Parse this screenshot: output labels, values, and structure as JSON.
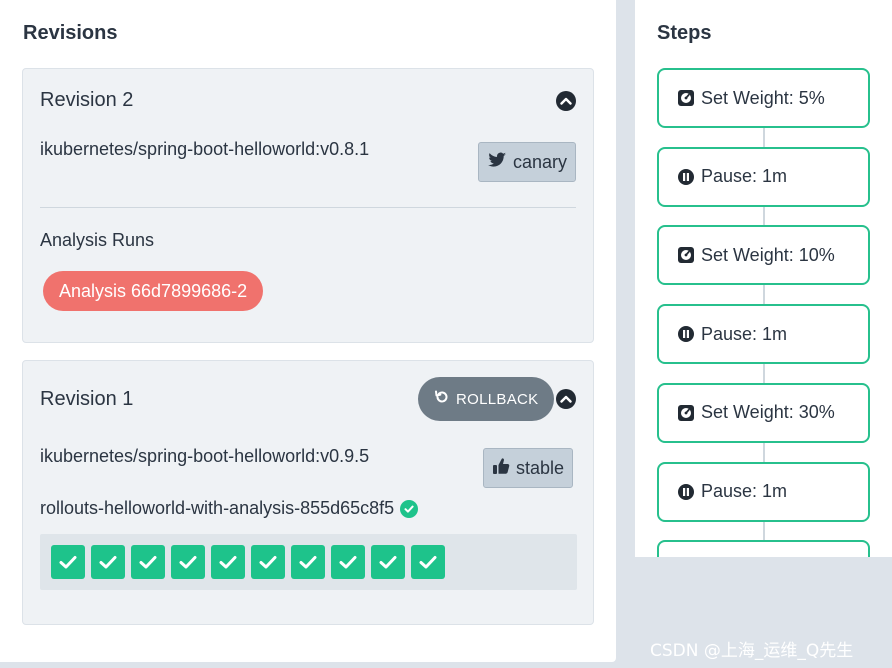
{
  "revisions_panel": {
    "title": "Revisions",
    "revisions": [
      {
        "title": "Revision 2",
        "image": "ikubernetes/spring-boot-helloworld:v0.8.1",
        "tag": "canary",
        "analysis_label": "Analysis Runs",
        "analysis_run": "Analysis 66d7899686-2",
        "analysis_color": "#f0726d"
      },
      {
        "title": "Revision 1",
        "rollback_label": "ROLLBACK",
        "image": "ikubernetes/spring-boot-helloworld:v0.9.5",
        "tag": "stable",
        "replicaset": "rollouts-helloworld-with-analysis-855d65c8f5",
        "pod_count": 10,
        "pod_status": "healthy",
        "pod_color": "#1ec38b"
      }
    ]
  },
  "steps_panel": {
    "title": "Steps",
    "accent": "#27c08d",
    "steps": [
      {
        "label": "Set Weight: 5%",
        "icon": "weight-icon"
      },
      {
        "label": "Pause: 1m",
        "icon": "pause-icon"
      },
      {
        "label": "Set Weight: 10%",
        "icon": "weight-icon"
      },
      {
        "label": "Pause: 1m",
        "icon": "pause-icon"
      },
      {
        "label": "Set Weight: 30%",
        "icon": "weight-icon"
      },
      {
        "label": "Pause: 1m",
        "icon": "pause-icon"
      }
    ]
  },
  "watermark": "CSDN @上海_运维_Q先生"
}
